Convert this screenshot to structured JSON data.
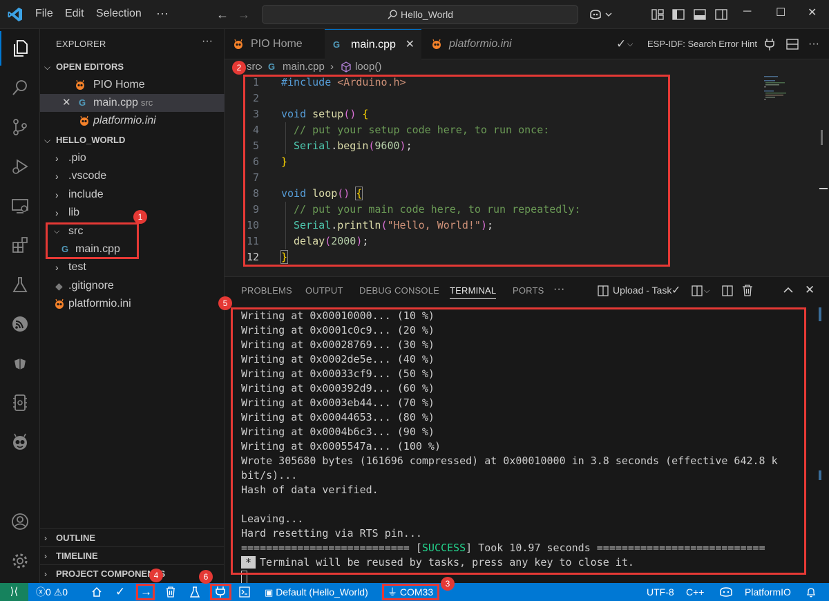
{
  "titlebar": {
    "menus": [
      "File",
      "Edit",
      "Selection"
    ],
    "more": "···",
    "search": "Hello_World"
  },
  "sidebar": {
    "header": "EXPLORER",
    "more": "···",
    "open_editors_label": "OPEN EDITORS",
    "open_editors": [
      {
        "name": "PIO Home",
        "sub": ""
      },
      {
        "name": "main.cpp",
        "sub": "src"
      },
      {
        "name": "platformio.ini",
        "sub": ""
      }
    ],
    "project_label": "HELLO_WORLD",
    "tree": [
      ".pio",
      ".vscode",
      "include",
      "lib",
      "src",
      "main.cpp",
      "test",
      ".gitignore",
      "platformio.ini"
    ],
    "outline": "OUTLINE",
    "timeline": "TIMELINE",
    "project_components": "PROJECT COMPONENTS"
  },
  "tabs": [
    {
      "label": "PIO Home"
    },
    {
      "label": "main.cpp"
    },
    {
      "label": "platformio.ini"
    }
  ],
  "editor_actions": {
    "hint": "ESP-IDF: Search Error Hint"
  },
  "breadcrumb": {
    "folder": "src",
    "file": "main.cpp",
    "symbol": "loop()"
  },
  "code": {
    "line_numbers": [
      "1",
      "2",
      "3",
      "4",
      "5",
      "6",
      "7",
      "8",
      "9",
      "10",
      "11",
      "12"
    ],
    "l1_kw": "#include",
    "l1_str": "<Arduino.h>",
    "l3_kw": "void",
    "l3_fn": "setup",
    "l4": "// put your setup code here, to run once:",
    "l5_cls": "Serial",
    "l5_fn": "begin",
    "l5_num": "9600",
    "l8_kw": "void",
    "l8_fn": "loop",
    "l9": "// put your main code here, to run repeatedly:",
    "l10_cls": "Serial",
    "l10_fn": "println",
    "l10_str": "\"Hello, World!\"",
    "l11_fn": "delay",
    "l11_num": "2000"
  },
  "panel": {
    "tabs": [
      "PROBLEMS",
      "OUTPUT",
      "DEBUG CONSOLE",
      "TERMINAL",
      "PORTS"
    ],
    "more": "···",
    "task": "Upload - Task",
    "terminal_lines": [
      "Writing at 0x00010000... (10 %)",
      "Writing at 0x0001c0c9... (20 %)",
      "Writing at 0x00028769... (30 %)",
      "Writing at 0x0002de5e... (40 %)",
      "Writing at 0x00033cf9... (50 %)",
      "Writing at 0x000392d9... (60 %)",
      "Writing at 0x0003eb44... (70 %)",
      "Writing at 0x00044653... (80 %)",
      "Writing at 0x0004b6c3... (90 %)",
      "Writing at 0x0005547a... (100 %)",
      "Wrote 305680 bytes (161696 compressed) at 0x00010000 in 3.8 seconds (effective 642.8 k",
      "bit/s)...",
      "Hash of data verified.",
      "",
      "Leaving...",
      "Hard resetting via RTS pin..."
    ],
    "success_prefix": "=========================== [",
    "success_word": "SUCCESS",
    "success_suffix": "] Took 10.97 seconds ===========================",
    "reuse_star": "*",
    "reuse_text": "Terminal will be reused by tasks, press any key to close it."
  },
  "statusbar": {
    "errors": "0",
    "warnings": "0",
    "env": "Default (Hello_World)",
    "port": "COM33",
    "encoding": "UTF-8",
    "language": "C++",
    "platformio": "PlatformIO"
  },
  "annotations": [
    "1",
    "2",
    "3",
    "4",
    "5",
    "6"
  ],
  "colors": {
    "accent": "#0078d4",
    "annotation": "#e53935",
    "pio_orange": "#f5822a",
    "success": "#23d18b"
  }
}
